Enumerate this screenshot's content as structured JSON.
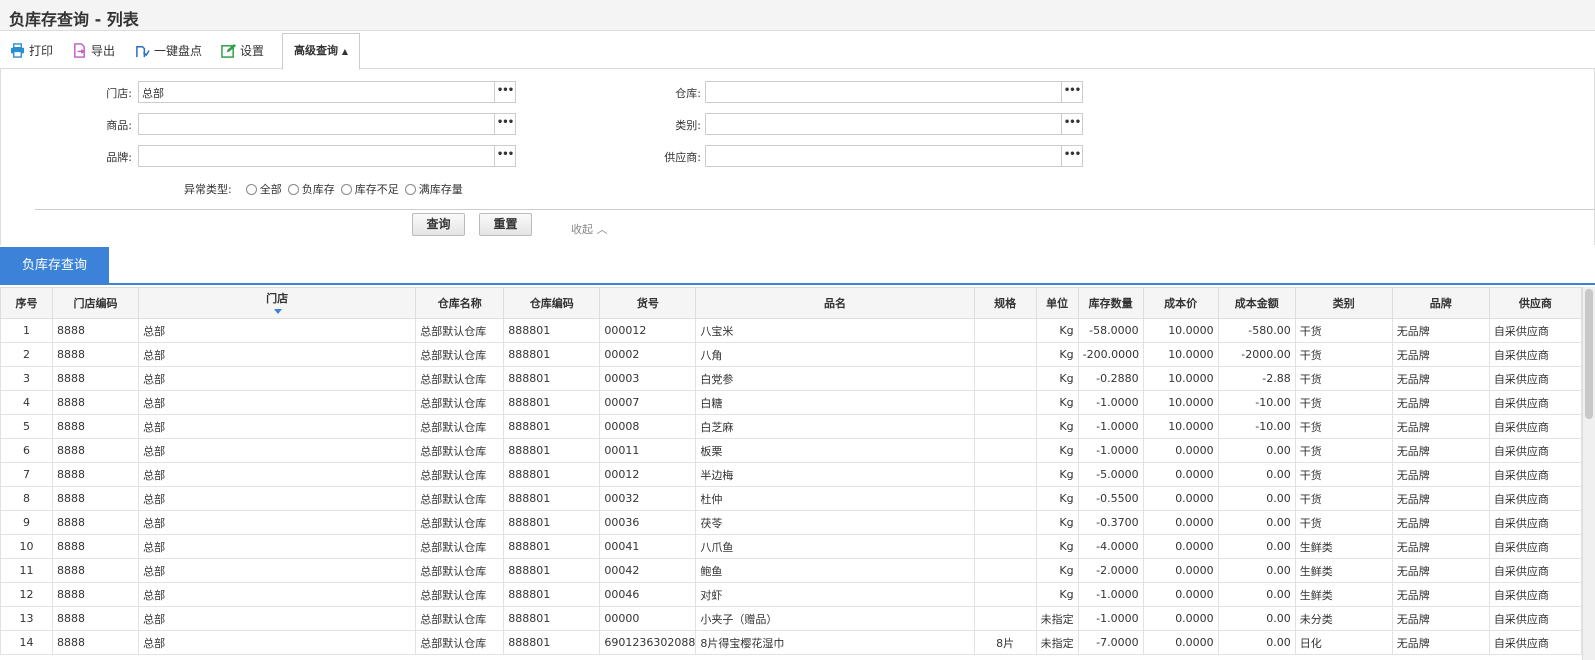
{
  "page": {
    "title": "负库存查询 - 列表"
  },
  "toolbar": {
    "print": "打印",
    "export": "导出",
    "stocktake": "一键盘点",
    "settings": "设置",
    "advanced": "高级查询"
  },
  "filters": {
    "store_label": "门店:",
    "store_value": "总部",
    "warehouse_label": "仓库:",
    "warehouse_value": "",
    "product_label": "商品:",
    "product_value": "",
    "category_label": "类别:",
    "category_value": "",
    "brand_label": "品牌:",
    "brand_value": "",
    "supplier_label": "供应商:",
    "supplier_value": "",
    "picker_glyph": "•••",
    "anomaly_label": "异常类型:",
    "anomaly_options": [
      "全部",
      "负库存",
      "库存不足",
      "满库存量"
    ],
    "query_button": "查询",
    "reset_button": "重置",
    "collapse": "收起 ︿"
  },
  "tabs": {
    "active": "负库存查询"
  },
  "table": {
    "columns": [
      "序号",
      "门店编码",
      "门店",
      "仓库名称",
      "仓库编码",
      "货号",
      "品名",
      "规格",
      "单位",
      "库存数量",
      "成本价",
      "成本金额",
      "类别",
      "品牌",
      "供应商"
    ],
    "rows": [
      [
        "1",
        "8888",
        "总部",
        "总部默认仓库",
        "888801",
        "000012",
        "八宝米",
        "",
        "Kg",
        "-58.0000",
        "10.0000",
        "-580.00",
        "干货",
        "无品牌",
        "自采供应商"
      ],
      [
        "2",
        "8888",
        "总部",
        "总部默认仓库",
        "888801",
        "00002",
        "八角",
        "",
        "Kg",
        "-200.0000",
        "10.0000",
        "-2000.00",
        "干货",
        "无品牌",
        "自采供应商"
      ],
      [
        "3",
        "8888",
        "总部",
        "总部默认仓库",
        "888801",
        "00003",
        "白党参",
        "",
        "Kg",
        "-0.2880",
        "10.0000",
        "-2.88",
        "干货",
        "无品牌",
        "自采供应商"
      ],
      [
        "4",
        "8888",
        "总部",
        "总部默认仓库",
        "888801",
        "00007",
        "白糖",
        "",
        "Kg",
        "-1.0000",
        "10.0000",
        "-10.00",
        "干货",
        "无品牌",
        "自采供应商"
      ],
      [
        "5",
        "8888",
        "总部",
        "总部默认仓库",
        "888801",
        "00008",
        "白芝麻",
        "",
        "Kg",
        "-1.0000",
        "10.0000",
        "-10.00",
        "干货",
        "无品牌",
        "自采供应商"
      ],
      [
        "6",
        "8888",
        "总部",
        "总部默认仓库",
        "888801",
        "00011",
        "板栗",
        "",
        "Kg",
        "-1.0000",
        "0.0000",
        "0.00",
        "干货",
        "无品牌",
        "自采供应商"
      ],
      [
        "7",
        "8888",
        "总部",
        "总部默认仓库",
        "888801",
        "00012",
        "半边梅",
        "",
        "Kg",
        "-5.0000",
        "0.0000",
        "0.00",
        "干货",
        "无品牌",
        "自采供应商"
      ],
      [
        "8",
        "8888",
        "总部",
        "总部默认仓库",
        "888801",
        "00032",
        "杜仲",
        "",
        "Kg",
        "-0.5500",
        "0.0000",
        "0.00",
        "干货",
        "无品牌",
        "自采供应商"
      ],
      [
        "9",
        "8888",
        "总部",
        "总部默认仓库",
        "888801",
        "00036",
        "茯苓",
        "",
        "Kg",
        "-0.3700",
        "0.0000",
        "0.00",
        "干货",
        "无品牌",
        "自采供应商"
      ],
      [
        "10",
        "8888",
        "总部",
        "总部默认仓库",
        "888801",
        "00041",
        "八爪鱼",
        "",
        "Kg",
        "-4.0000",
        "0.0000",
        "0.00",
        "生鲜类",
        "无品牌",
        "自采供应商"
      ],
      [
        "11",
        "8888",
        "总部",
        "总部默认仓库",
        "888801",
        "00042",
        "鲍鱼",
        "",
        "Kg",
        "-2.0000",
        "0.0000",
        "0.00",
        "生鲜类",
        "无品牌",
        "自采供应商"
      ],
      [
        "12",
        "8888",
        "总部",
        "总部默认仓库",
        "888801",
        "00046",
        "对虾",
        "",
        "Kg",
        "-1.0000",
        "0.0000",
        "0.00",
        "生鲜类",
        "无品牌",
        "自采供应商"
      ],
      [
        "13",
        "8888",
        "总部",
        "总部默认仓库",
        "888801",
        "00000",
        "小夹子（赠品）",
        "",
        "未指定",
        "-1.0000",
        "0.0000",
        "0.00",
        "未分类",
        "无品牌",
        "自采供应商"
      ],
      [
        "14",
        "8888",
        "总部",
        "总部默认仓库",
        "888801",
        "6901236302088",
        "8片得宝樱花湿巾",
        "8片",
        "未指定",
        "-7.0000",
        "0.0000",
        "0.00",
        "日化",
        "无品牌",
        "自采供应商"
      ]
    ]
  },
  "colors": {
    "accent": "#3b82d8",
    "icon_print": "#2a8fd0",
    "icon_export": "#c05ac0",
    "icon_stocktake": "#2a6fc4",
    "icon_settings": "#2fa04a"
  }
}
